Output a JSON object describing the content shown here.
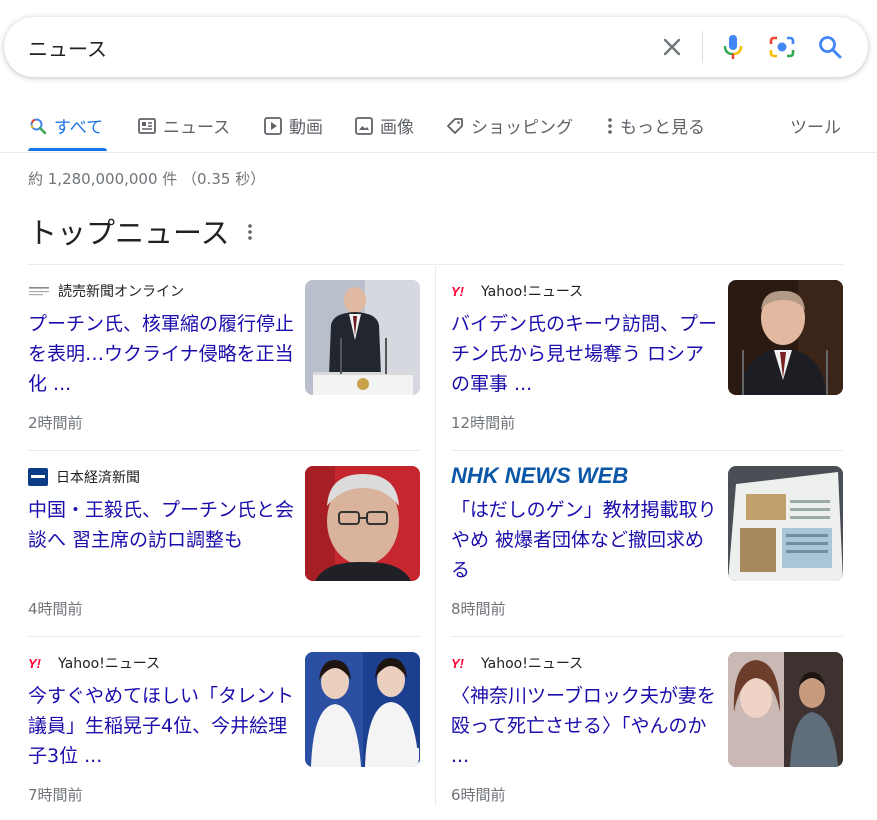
{
  "search": {
    "query": "ニュース"
  },
  "tabs": [
    {
      "label": "すべて",
      "icon": "search-icon"
    },
    {
      "label": "ニュース",
      "icon": "news-icon"
    },
    {
      "label": "動画",
      "icon": "play-icon"
    },
    {
      "label": "画像",
      "icon": "image-icon"
    },
    {
      "label": "ショッピング",
      "icon": "tag-icon"
    },
    {
      "label": "もっと見る",
      "icon": "more-vert-icon"
    }
  ],
  "tools_label": "ツール",
  "result_stats": "約 1,280,000,000 件 （0.35 秒）",
  "section_title": "トップニュース",
  "colors": {
    "accent": "#1a73e8",
    "link": "#1a0dab",
    "muted": "#70757a",
    "yahoo_red": "#ff0033",
    "nikkei_blue": "#0b3c86",
    "nhk_blue": "#0a56a7"
  },
  "articles": [
    {
      "source": "読売新聞オンライン",
      "headline": "プーチン氏、核軍縮の履行停止を表明…ウクライナ侵略を正当化 ...",
      "time": "2時間前",
      "logo": "yomiuri-logo"
    },
    {
      "source": "Yahoo!ニュース",
      "headline": "バイデン氏のキーウ訪問、プーチン氏から見せ場奪う ロシアの軍事 ...",
      "time": "12時間前",
      "logo": "yahoo-logo"
    },
    {
      "source": "日本経済新聞",
      "headline": "中国・王毅氏、プーチン氏と会談へ 習主席の訪ロ調整も",
      "time": "4時間前",
      "logo": "nikkei-logo"
    },
    {
      "source": "NHK NEWS WEB",
      "headline": "「はだしのゲン」教材掲載取りやめ 被爆者団体など撤回求める",
      "time": "8時間前",
      "logo": "nhk-logo"
    },
    {
      "source": "Yahoo!ニュース",
      "headline": "今すぐやめてほしい「タレント議員」生稲晃子4位、今井絵理子3位 ...",
      "time": "7時間前",
      "logo": "yahoo-logo"
    },
    {
      "source": "Yahoo!ニュース",
      "headline": "〈神奈川ツーブロック夫が妻を殴って死亡させる〉「やんのか ...",
      "time": "6時間前",
      "logo": "yahoo-logo"
    }
  ]
}
